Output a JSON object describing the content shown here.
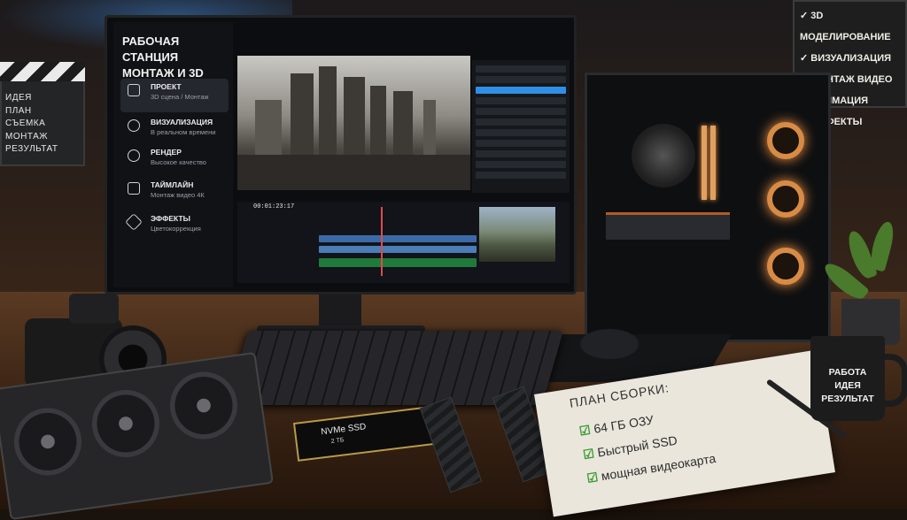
{
  "board": {
    "items": [
      "ИДЕЯ",
      "ПЛАН",
      "СЪЕМКА",
      "МОНТАЖ",
      "РЕЗУЛЬТАТ"
    ]
  },
  "sign": {
    "items": [
      "3D МОДЕЛИРОВАНИЕ",
      "ВИЗУАЛИЗАЦИЯ",
      "МОНТАЖ ВИДЕО",
      "АНИМАЦИЯ",
      "ЭФФЕКТЫ"
    ]
  },
  "screen": {
    "title_line1": "РАБОЧАЯ СТАНЦИЯ",
    "title_line2": "МОНТАЖ И 3D",
    "menu": [
      {
        "label": "ПРОЕКТ",
        "sub": "3D сцена / Монтаж",
        "icon": "file-icon"
      },
      {
        "label": "ВИЗУАЛИЗАЦИЯ",
        "sub": "В реальном времени",
        "icon": "camera-icon"
      },
      {
        "label": "РЕНДЕР",
        "sub": "Высокое качество",
        "icon": "camera-icon"
      },
      {
        "label": "ТАЙМЛАЙН",
        "sub": "Монтаж видео 4К",
        "icon": "film-icon"
      },
      {
        "label": "ЭФФЕКТЫ",
        "sub": "Цветокоррекция",
        "icon": "puzzle-icon"
      }
    ],
    "timecode": "00:01:23:17",
    "accent": "#2f8fe6"
  },
  "ssd": {
    "title": "NVMe SSD",
    "capacity": "2 ТБ"
  },
  "notebook": {
    "title": "ПЛАН СБОРКИ:",
    "items": [
      "64 ГБ ОЗУ",
      "Быстрый SSD",
      "мощная видеокарта"
    ]
  },
  "mug": {
    "lines": [
      "РАБОТА",
      "ИДЕЯ",
      "РЕЗУЛЬТАТ"
    ]
  },
  "colors": {
    "fan_glow": "#ff9a45",
    "check": "#3a9a35"
  }
}
